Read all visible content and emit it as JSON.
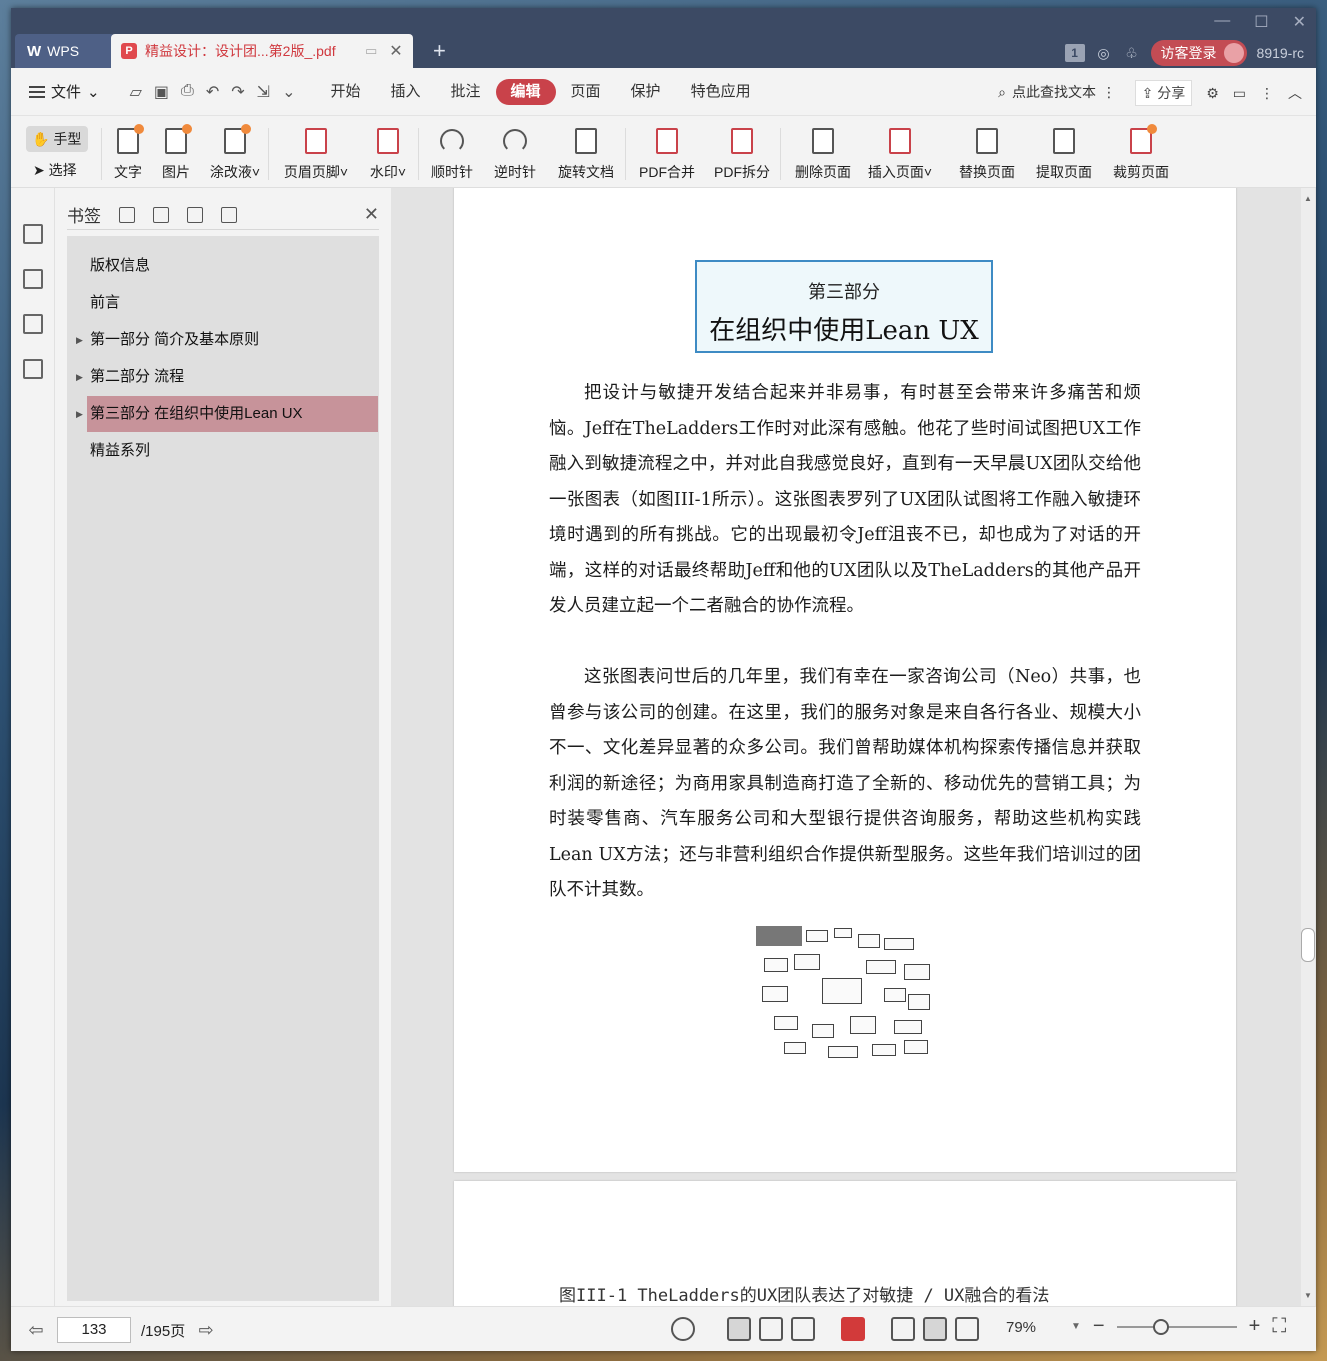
{
  "app": {
    "name": "WPS",
    "doc_tab_title": "精益设计：设计团...第2版_.pdf",
    "login": "访客登录",
    "version": "8919-rc",
    "tab_count": "1"
  },
  "menu": {
    "file": "文件",
    "tabs": [
      "开始",
      "插入",
      "批注",
      "编辑",
      "页面",
      "保护",
      "特色应用"
    ],
    "active_tab": "编辑",
    "search": "点此查找文本",
    "share": "分享"
  },
  "ribbon": {
    "hand": "手型",
    "select": "选择",
    "tools": [
      "文字",
      "图片",
      "涂改液",
      "页眉页脚",
      "水印",
      "顺时针",
      "逆时针",
      "旋转文档",
      "PDF合并",
      "PDF拆分",
      "删除页面",
      "插入页面",
      "替换页面",
      "提取页面",
      "裁剪页面"
    ]
  },
  "bookmarks": {
    "title": "书签",
    "items": [
      {
        "label": "版权信息",
        "expandable": false,
        "selected": false
      },
      {
        "label": "前言",
        "expandable": false,
        "selected": false
      },
      {
        "label": "第一部分 简介及基本原则",
        "expandable": true,
        "selected": false
      },
      {
        "label": "第二部分 流程",
        "expandable": true,
        "selected": false
      },
      {
        "label": "第三部分 在组织中使用Lean UX",
        "expandable": true,
        "selected": true
      },
      {
        "label": "精益系列",
        "expandable": false,
        "selected": false
      }
    ]
  },
  "page": {
    "part_label": "第三部分",
    "part_title": "在组织中使用Lean UX",
    "paragraph1": "把设计与敏捷开发结合起来并非易事，有时甚至会带来许多痛苦和烦恼。Jeff在TheLadders工作时对此深有感触。他花了些时间试图把UX工作融入到敏捷流程之中，并对此自我感觉良好，直到有一天早晨UX团队交给他一张图表（如图III-1所示）。这张图表罗列了UX团队试图将工作融入敏捷环境时遇到的所有挑战。它的出现最初令Jeff沮丧不已，却也成为了对话的开端，这样的对话最终帮助Jeff和他的UX团队以及TheLadders的其他产品开发人员建立起一个二者融合的协作流程。",
    "paragraph2": "这张图表问世后的几年里，我们有幸在一家咨询公司（Neo）共事，也曾参与该公司的创建。在这里，我们的服务对象是来自各行各业、规模大小不一、文化差异显著的众多公司。我们曾帮助媒体机构探索传播信息并获取利润的新途径；为商用家具制造商打造了全新的、移动优先的营销工具；为时装零售商、汽车服务公司和大型银行提供咨询服务，帮助这些机构实践Lean UX方法；还与非营利组织合作提供新型服务。这些年我们培训过的团队不计其数。",
    "caption": "图III-1 TheLadders的UX团队表达了对敏捷 / UX融合的看法"
  },
  "status": {
    "current_page": "133",
    "total_pages": "/195页",
    "zoom": "79%"
  }
}
